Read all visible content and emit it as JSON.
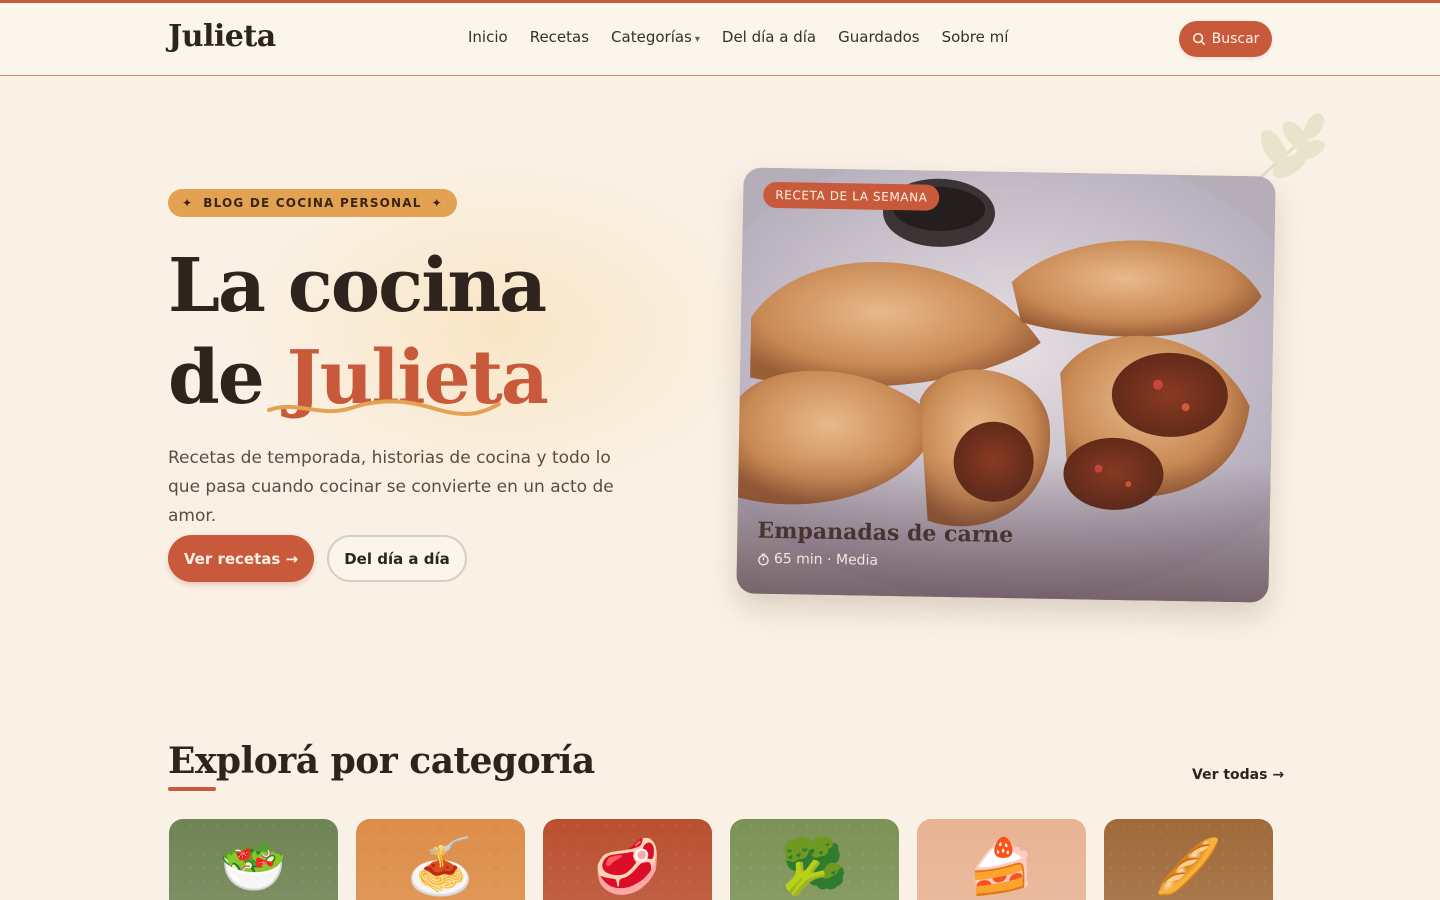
{
  "brand": {
    "logo": "Julieta"
  },
  "nav": {
    "items": [
      "Inicio",
      "Recetas",
      "Categorías",
      "Del día a día",
      "Guardados",
      "Sobre mí"
    ],
    "categories_caret": "▾",
    "search_label": "Buscar"
  },
  "hero": {
    "badge": "BLOG DE COCINA PERSONAL",
    "badge_star": "✦",
    "title_line1": "La cocina",
    "title_line2_prefix": "de",
    "title_line2_accent": "Julieta",
    "description": "Recetas de temporada, historias de cocina y todo lo que pasa cuando cocinar se convierte en un acto de amor.",
    "primary_button": "Ver recetas →",
    "secondary_button": "Del día a día"
  },
  "featured": {
    "tag": "RECETA DE LA SEMANA",
    "name": "Empanadas de carne",
    "meta": "65 min · Media"
  },
  "categories": {
    "title": "Explorá por categoría",
    "see_all": "Ver todas →",
    "cards": [
      {
        "icon": "salad-icon",
        "glyph": "🥗",
        "color": "#6f8454"
      },
      {
        "icon": "spaghetti-icon",
        "glyph": "🍝",
        "color": "#dd8d48"
      },
      {
        "icon": "meat-icon",
        "glyph": "🥩",
        "color": "#b9502f"
      },
      {
        "icon": "broccoli-icon",
        "glyph": "🥦",
        "color": "#7b9256"
      },
      {
        "icon": "cake-icon",
        "glyph": "🍰",
        "color": "#e9b394"
      },
      {
        "icon": "bread-icon",
        "glyph": "🥖",
        "color": "#a06a3a"
      }
    ]
  },
  "colors": {
    "accent": "#c85a3b",
    "badge": "#e3a152",
    "background": "#faf1e6",
    "text": "#2e241d"
  }
}
